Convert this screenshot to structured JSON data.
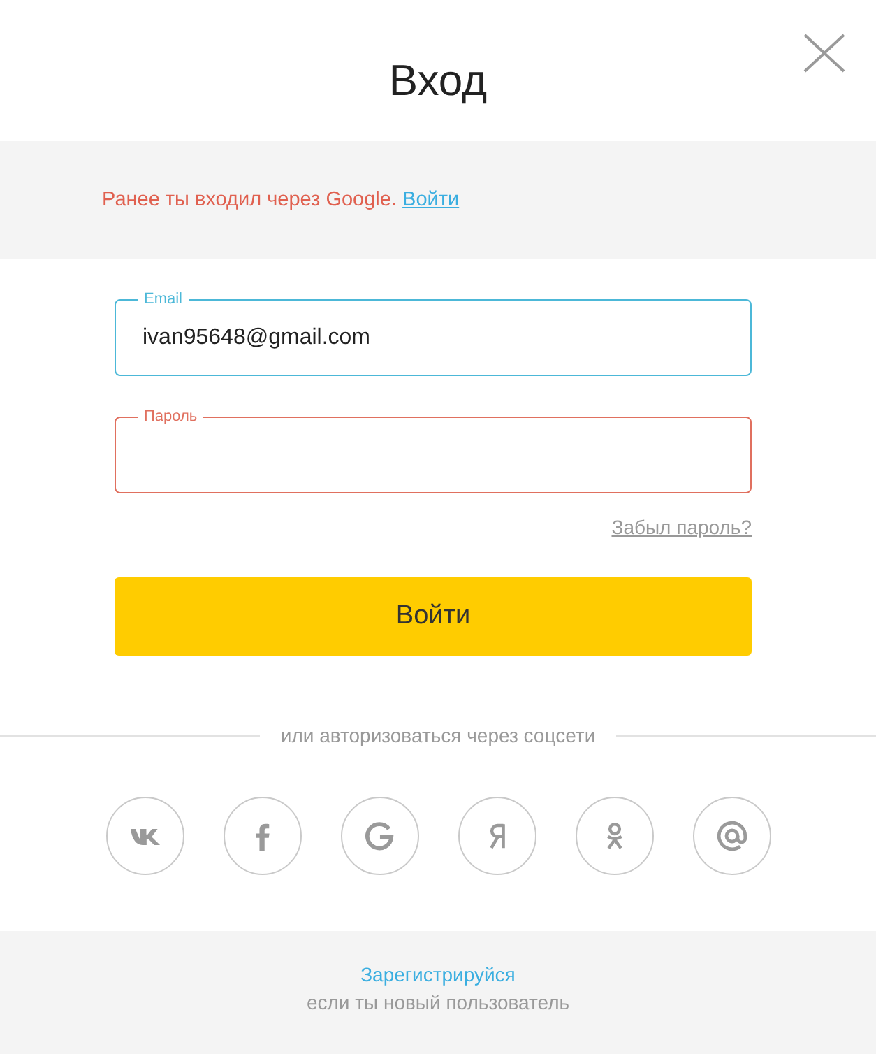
{
  "dialog": {
    "title": "Вход"
  },
  "notice": {
    "text": "Ранее ты входил через Google.",
    "link": "Войти"
  },
  "fields": [
    {
      "label": "Email",
      "value": "ivan95648@gmail.com",
      "focused": true,
      "invalid": false
    },
    {
      "label": "Пароль",
      "focused": false,
      "invalid": true
    }
  ],
  "forgot_link": "Забыл пароль?",
  "submit_button": "Войти",
  "social": {
    "caption": "или авторизоваться через соцсети"
  },
  "signup": {
    "link": "Зарегистрируйся",
    "hint": "если ты новый пользователь"
  }
}
